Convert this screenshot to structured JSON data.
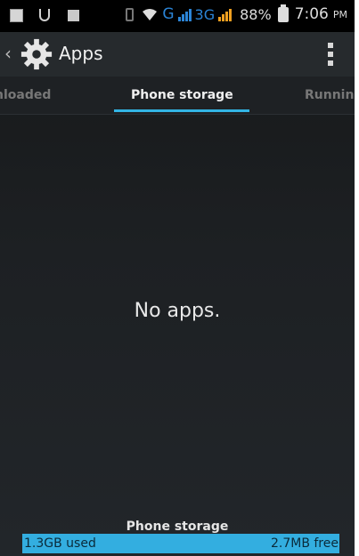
{
  "status_bar": {
    "network_g": "G",
    "network_3g": "3G",
    "battery_percent": "88%",
    "time": "7:06",
    "ampm": "PM",
    "icons": [
      "notification-icon",
      "usb-icon",
      "square-icon",
      "vibrate-icon",
      "wifi-icon",
      "signal-g-icon",
      "signal-3g-icon",
      "battery-icon"
    ]
  },
  "action_bar": {
    "title": "Apps",
    "back_icon": "chevron-left-icon",
    "app_icon": "gear-icon",
    "menu_icon": "overflow-menu-icon"
  },
  "tabs": [
    {
      "label": "nloaded",
      "selected": false
    },
    {
      "label": "Phone storage",
      "selected": true
    },
    {
      "label": "Running",
      "selected": false
    }
  ],
  "main": {
    "empty_message": "No apps."
  },
  "storage": {
    "label": "Phone storage",
    "used": "1.3GB used",
    "free": "2.7MB free"
  },
  "colors": {
    "accent": "#33b5e5",
    "background": "#1d2023"
  }
}
